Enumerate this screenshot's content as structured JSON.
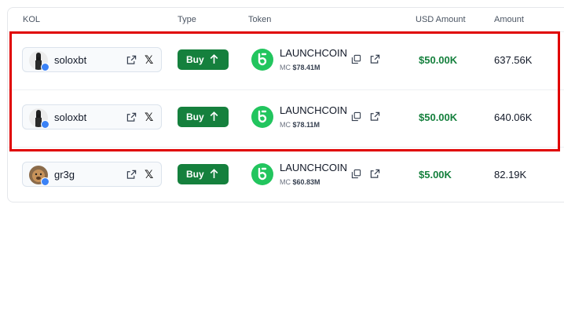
{
  "columns": {
    "kol": "KOL",
    "type": "Type",
    "token": "Token",
    "usd": "USD Amount",
    "amount": "Amount"
  },
  "rows": [
    {
      "kol": {
        "name": "soloxbt",
        "avatar": "bw-figure"
      },
      "type": "Buy",
      "token": {
        "name": "LAUNCHCOIN",
        "mc_label": "MC",
        "mc_value": "$78.41M"
      },
      "usd": "$50.00K",
      "amount": "637.56K"
    },
    {
      "kol": {
        "name": "soloxbt",
        "avatar": "bw-figure"
      },
      "type": "Buy",
      "token": {
        "name": "LAUNCHCOIN",
        "mc_label": "MC",
        "mc_value": "$78.11M"
      },
      "usd": "$50.00K",
      "amount": "640.06K"
    },
    {
      "kol": {
        "name": "gr3g",
        "avatar": "brown-dog"
      },
      "type": "Buy",
      "token": {
        "name": "LAUNCHCOIN",
        "mc_label": "MC",
        "mc_value": "$60.83M"
      },
      "usd": "$5.00K",
      "amount": "82.19K"
    }
  ],
  "icons": {
    "external_link": "external-link-icon",
    "x": "x-logo-icon",
    "arrow_up": "arrow-up-icon",
    "copy": "copy-icon",
    "token_logo": "launchcoin-logo",
    "verified_dot": "verified-dot"
  },
  "colors": {
    "accent_green": "#15803d",
    "token_green": "#22c55e",
    "highlight_red": "#e00000",
    "verified_blue": "#3b82f6"
  }
}
